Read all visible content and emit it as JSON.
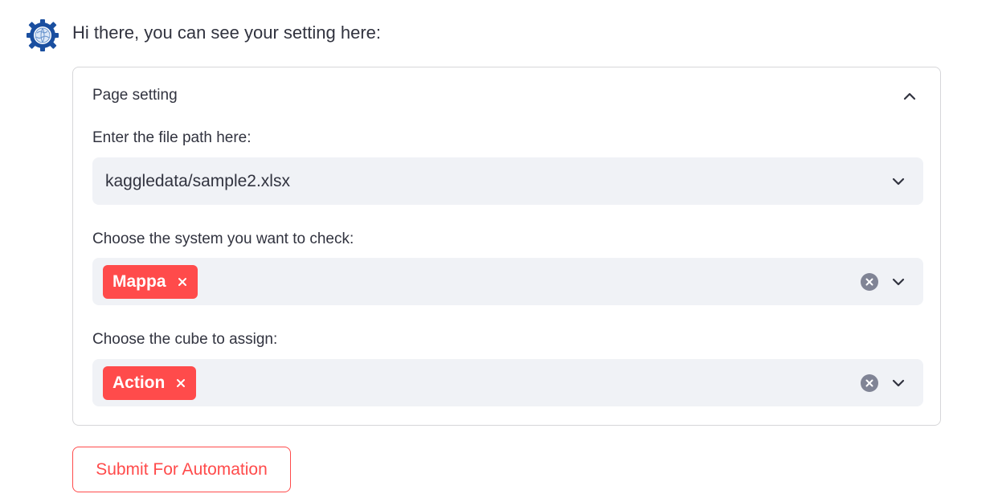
{
  "chat": {
    "avatar_icon": "gear-globe-icon",
    "message": "Hi there, you can see your setting here:"
  },
  "expander": {
    "title": "Page setting",
    "expanded": true,
    "file_path": {
      "label": "Enter the file path here:",
      "value": "kaggledata/sample2.xlsx"
    },
    "system_select": {
      "label": "Choose the system you want to check:",
      "selected": [
        "Mappa"
      ]
    },
    "cube_select": {
      "label": "Choose the cube to assign:",
      "selected": [
        "Action"
      ]
    }
  },
  "submit_button": {
    "label": "Submit For Automation"
  },
  "colors": {
    "accent": "#ff4b4b",
    "field_bg": "#f0f2f6",
    "text": "#31333f",
    "border": "#d6d6d9"
  }
}
